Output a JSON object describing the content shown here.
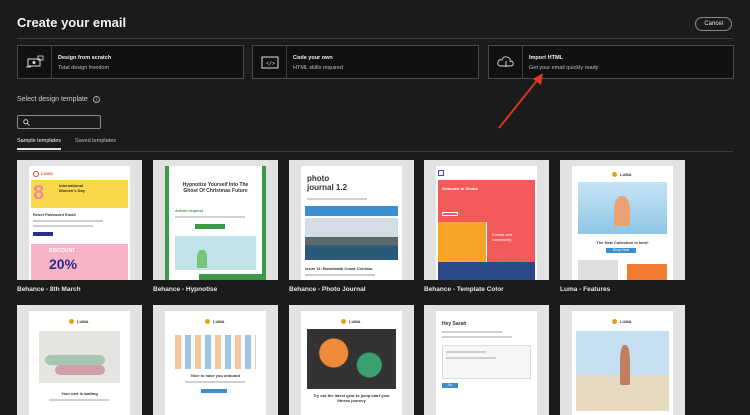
{
  "header": {
    "title": "Create your email",
    "cancel_label": "Cancel"
  },
  "options": [
    {
      "title": "Design from scratch",
      "subtitle": "Total design freedom"
    },
    {
      "title": "Code your own",
      "subtitle": "HTML skills required"
    },
    {
      "title": "Import HTML",
      "subtitle": "Get your email quickly ready"
    }
  ],
  "section": {
    "title": "Select design template",
    "info": "i"
  },
  "search": {
    "placeholder": ""
  },
  "tabs": [
    "Sample templates",
    "Saved templates"
  ],
  "templates": [
    {
      "label": "Behance - 8th March",
      "logo": "LOGO",
      "headline": "International Women's Day",
      "reset": "Reset Password Email",
      "big": "20%",
      "discount": "DISCOUNT"
    },
    {
      "label": "Behance - Hypnotise",
      "headline": "Hypnotize Yourself Into The Ghost Of Christmas Future",
      "sub": "Action request"
    },
    {
      "label": "Behance - Photo Journal",
      "headline": "photo journal 1.2",
      "caption": "Issue 11: Boardwalk Coast Corridor"
    },
    {
      "label": "Behance - Template Color",
      "headline": "Welcome to Studio",
      "sub": "Events and community"
    },
    {
      "label": "Luma - Features",
      "brand": "LUMA",
      "headline": "The New Collection is here!",
      "cta": "Shop Now"
    },
    {
      "brand": "LUMA",
      "headline": "Your cart is waiting"
    },
    {
      "brand": "LUMA",
      "headline": "Nice to have you onboard"
    },
    {
      "brand": "LUMA",
      "headline": "Try out the latest gear to jump start your fitness journey"
    },
    {
      "headline": "Hey Sarah",
      "cta": "Go"
    },
    {
      "brand": "LUMA"
    }
  ],
  "colors": {
    "annotation_arrow": "#e03a22",
    "background": "#1b1b1b"
  }
}
